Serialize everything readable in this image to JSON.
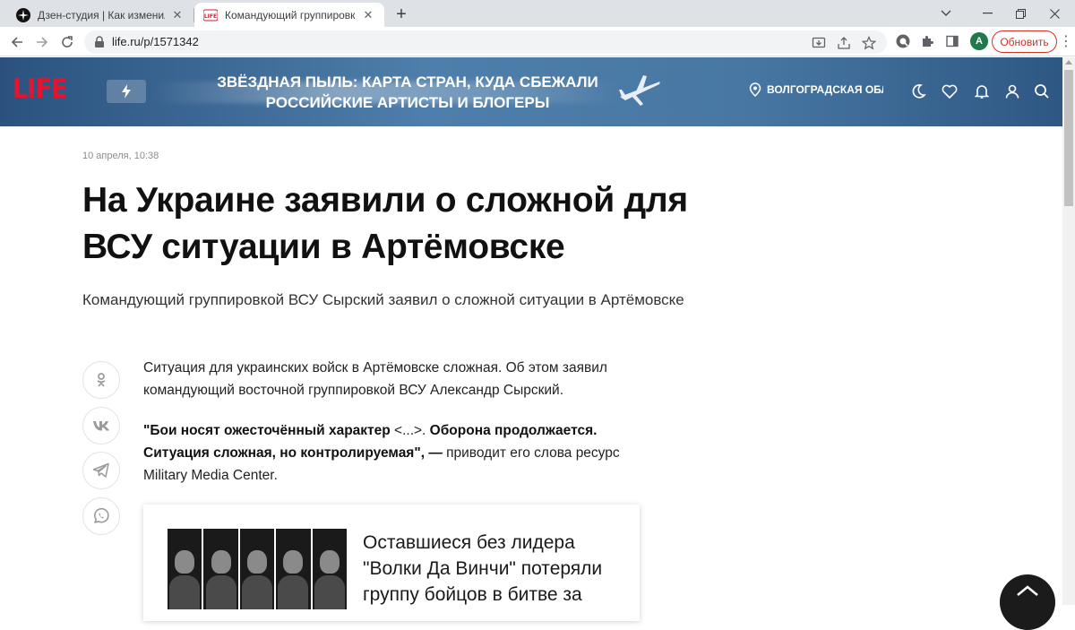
{
  "browser": {
    "tabs": [
      {
        "title": "Дзен-студия | Как изменились Р",
        "favicon": "dzen-icon",
        "active": false
      },
      {
        "title": "Командующий группировкой В",
        "favicon": "life-icon",
        "active": true
      }
    ],
    "url": "life.ru/p/1571342",
    "profile_initial": "A",
    "update_label": "Обновить",
    "window_controls": [
      "chevron-down-icon",
      "minimize-icon",
      "restore-icon",
      "close-icon"
    ]
  },
  "site": {
    "logo": "LIFE",
    "promo_line1": "ЗВЁЗДНАЯ ПЫЛЬ: КАРТА СТРАН, КУДА СБЕЖАЛИ",
    "promo_line2": "РОССИЙСКИЕ АРТИСТЫ И БЛОГЕРЫ",
    "region": "ВОЛГОГРАДСКАЯ ОБЛ...",
    "header_icons": [
      "moon-icon",
      "heart-icon",
      "bell-icon",
      "user-icon",
      "search-icon"
    ],
    "brand_red": "#e3142d",
    "header_blue": "#3d6b99"
  },
  "article": {
    "date": "10 апреля, 10:38",
    "headline": "На Украине заявили о сложной для ВСУ ситуации в Артёмовске",
    "lead": "Командующий группировкой ВСУ Сырский заявил о сложной ситуации в Артёмовске",
    "share_icons": [
      "odnoklassniki-icon",
      "vk-icon",
      "telegram-icon",
      "whatsapp-icon"
    ],
    "para1": "Ситуация для украинских войск в Артёмовске сложная. Об этом заявил командующий восточной группировкой ВСУ Александр Сырский.",
    "quote_part1": "\"Бои носят ожесточённый характер",
    "quote_ellipsis": " <...>. ",
    "quote_part2": "Оборона продолжается. Ситуация сложная, но контролируемая\", —",
    "para2_tail": " приводит его слова ресурс Military Media Center.",
    "related": {
      "title": "Оставшиеся без лидера \"Волки Да Винчи\" потеряли группу бойцов в битве за"
    }
  }
}
